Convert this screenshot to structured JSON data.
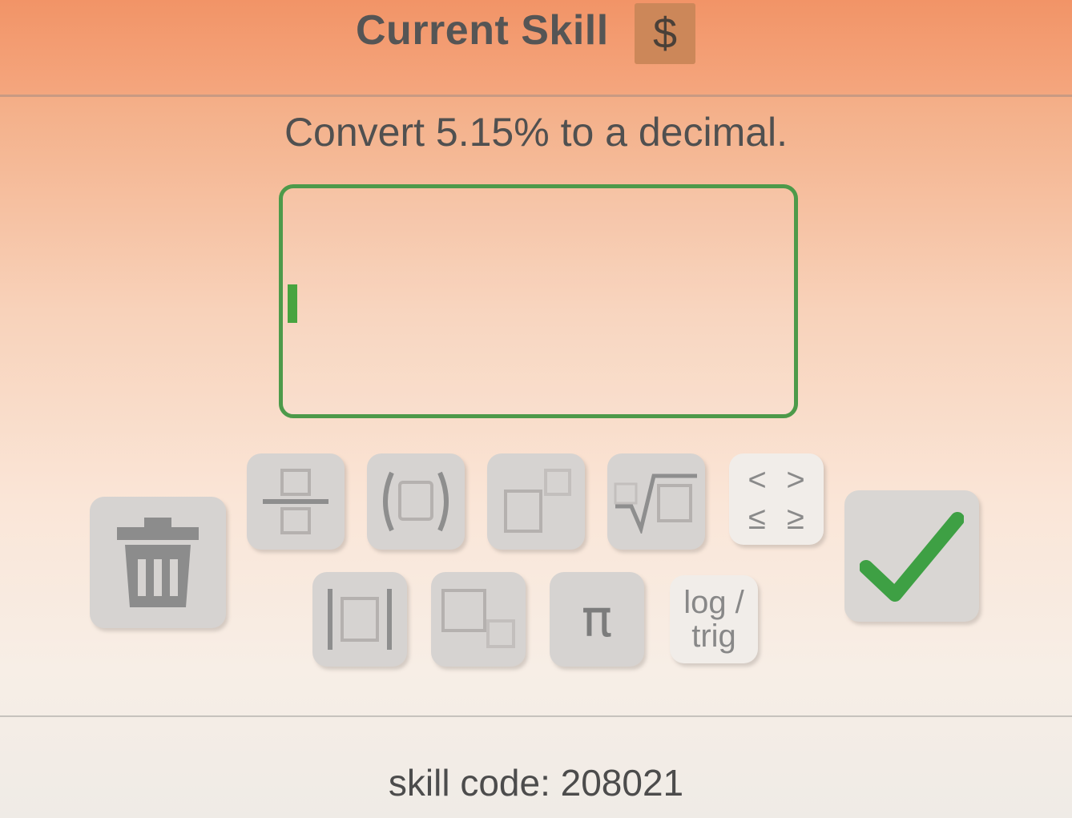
{
  "header": {
    "title": "Current Skill",
    "badge_symbol": "$",
    "background_color": "#f29467",
    "badge_color": "#cc8759"
  },
  "question": {
    "text": "Convert 5.15% to a decimal."
  },
  "answer": {
    "value": "",
    "border_color": "#4d9a4a"
  },
  "keypad": {
    "row1": [
      {
        "icon": "fraction-icon"
      },
      {
        "icon": "parentheses-icon"
      },
      {
        "icon": "exponent-icon"
      },
      {
        "icon": "square-root-icon"
      },
      {
        "icon": "inequality-icon",
        "symbols": [
          "<",
          ">",
          "≤",
          "≥"
        ]
      }
    ],
    "row2": [
      {
        "icon": "absolute-value-icon"
      },
      {
        "icon": "subscript-icon"
      },
      {
        "icon": "pi-icon",
        "label": "π"
      },
      {
        "icon": "log-trig-icon",
        "label_line1": "log /",
        "label_line2": "trig"
      }
    ],
    "delete_icon": "trash-icon",
    "submit_icon": "checkmark-icon",
    "check_color": "#3ea044"
  },
  "footer": {
    "skill_code": "skill code: 208021"
  }
}
